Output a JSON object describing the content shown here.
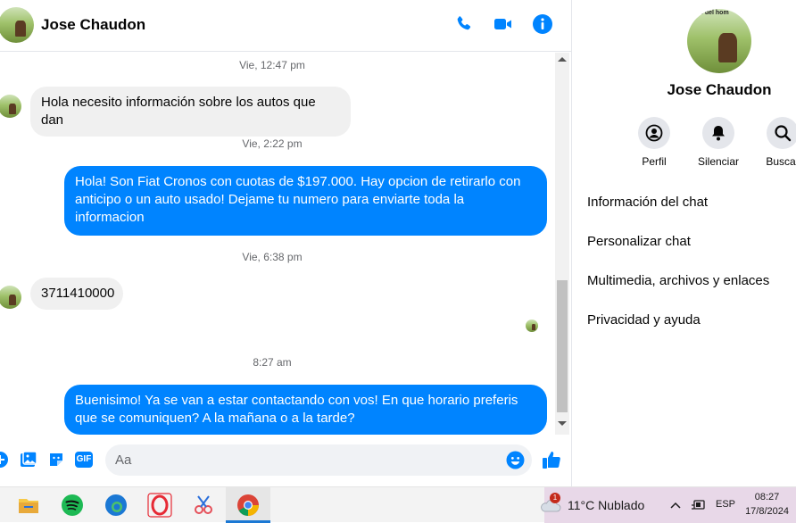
{
  "header": {
    "contact_name": "Jose Chaudon",
    "icons": [
      "phone-icon",
      "video-icon",
      "info-icon"
    ]
  },
  "messages": [
    {
      "type": "timestamp",
      "text": "Vie, 12:47 pm"
    },
    {
      "type": "incoming",
      "text": "Hola necesito información sobre los autos que dan"
    },
    {
      "type": "timestamp",
      "text": "Vie, 2:22 pm"
    },
    {
      "type": "outgoing",
      "text": "Hola! Son Fiat Cronos con cuotas de $197.000. Hay opcion de retirarlo con anticipo o un auto usado! Dejame tu numero para enviarte toda la informacion"
    },
    {
      "type": "timestamp",
      "text": "Vie, 6:38 pm"
    },
    {
      "type": "incoming",
      "text": "3711410000"
    },
    {
      "type": "timestamp",
      "text": "8:27 am"
    },
    {
      "type": "outgoing",
      "text": "Buenisimo! Ya se van a estar contactando con vos! En que horario preferis que se comuniquen? A la mañana o a la tarde?"
    }
  ],
  "composer": {
    "placeholder": "Aa",
    "gif_label": "GIF"
  },
  "panel": {
    "name": "Jose Chaudon",
    "avatar_caption": "s del hom",
    "actions": [
      {
        "label": "Perfil",
        "icon": "profile-icon"
      },
      {
        "label": "Silenciar",
        "icon": "bell-icon"
      },
      {
        "label": "Buscar",
        "icon": "search-icon"
      }
    ],
    "menu": [
      "Información del chat",
      "Personalizar chat",
      "Multimedia, archivos y enlaces",
      "Privacidad y ayuda"
    ]
  },
  "taskbar": {
    "weather": "11°C  Nublado",
    "weather_badge": "1",
    "language": "ESP",
    "time": "08:27",
    "date": "17/8/2024"
  },
  "colors": {
    "accent": "#0084ff",
    "incoming_bubble": "#f0f0f0",
    "outgoing_bubble": "#0084ff",
    "timestamp": "#65676b"
  }
}
